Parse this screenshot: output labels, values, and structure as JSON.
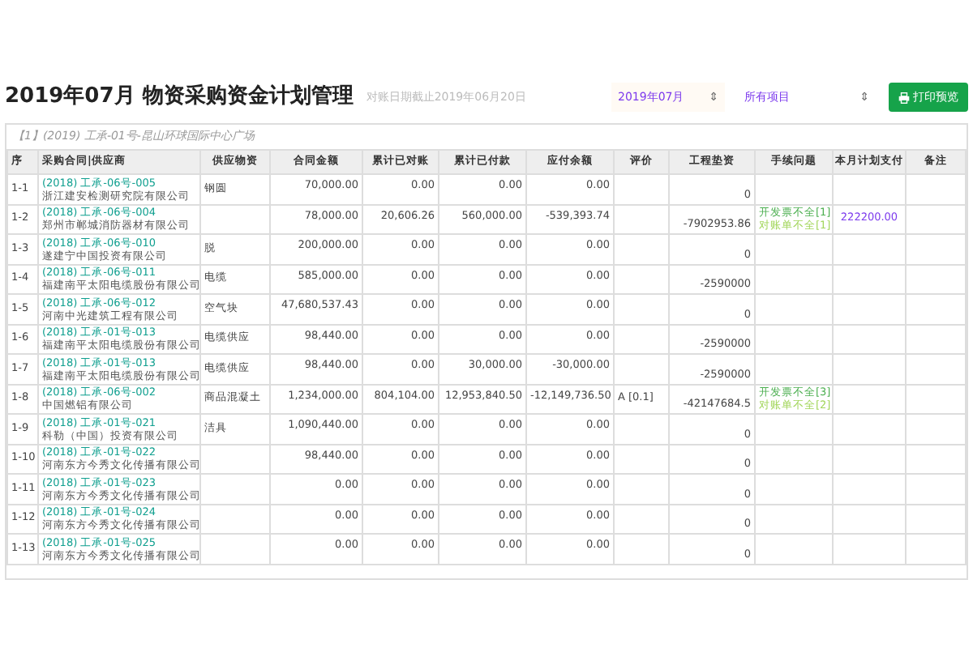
{
  "title": "2019年07月 物资采购资金计划管理",
  "subtitle": "对账日期截止2019年06月20日",
  "month_select": {
    "value": "2019年07月",
    "caret": "⇕"
  },
  "project_select": {
    "value": "所有项目",
    "caret": "⇕"
  },
  "print_button": {
    "label": "打印预览"
  },
  "section": {
    "title": "【1】(2019) 工承-01号-昆山环球国际中心广场"
  },
  "columns": [
    "序",
    "采购合同|供应商",
    "供应物资",
    "合同金额",
    "累计已对账",
    "累计已付款",
    "应付余额",
    "评价",
    "工程垫资",
    "手续问题",
    "本月计划支付",
    "备注"
  ],
  "rows": [
    {
      "no": "1-1",
      "contract": "(2018) 工承-06号-005",
      "supplier": "浙江建安检测研究院有限公司",
      "material": "钢圆",
      "amount": "70,000.00",
      "reconciled": "0.00",
      "paid": "0.00",
      "balance": "0.00",
      "rating": "",
      "advance": "0",
      "issues": [],
      "plan": ""
    },
    {
      "no": "1-2",
      "contract": "(2018) 工承-06号-004",
      "supplier": "郑州市郸城消防器材有限公司",
      "material": "",
      "amount": "78,000.00",
      "reconciled": "20,606.26",
      "paid": "560,000.00",
      "balance": "-539,393.74",
      "rating": "",
      "advance": "-7902953.86",
      "issues": [
        "开发票不全[1]",
        "对账单不全[1]"
      ],
      "plan": "222200.00"
    },
    {
      "no": "1-3",
      "contract": "(2018) 工承-06号-010",
      "supplier": "遂建宁中国投资有限公司",
      "material": "脱",
      "amount": "200,000.00",
      "reconciled": "0.00",
      "paid": "0.00",
      "balance": "0.00",
      "rating": "",
      "advance": "0",
      "issues": [],
      "plan": ""
    },
    {
      "no": "1-4",
      "contract": "(2018) 工承-06号-011",
      "supplier": "福建南平太阳电缆股份有限公司",
      "material": "电缆",
      "amount": "585,000.00",
      "reconciled": "0.00",
      "paid": "0.00",
      "balance": "0.00",
      "rating": "",
      "advance": "-2590000",
      "issues": [],
      "plan": ""
    },
    {
      "no": "1-5",
      "contract": "(2018) 工承-06号-012",
      "supplier": "河南中光建筑工程有限公司",
      "material": "空气块",
      "amount": "47,680,537.43",
      "reconciled": "0.00",
      "paid": "0.00",
      "balance": "0.00",
      "rating": "",
      "advance": "0",
      "issues": [],
      "plan": ""
    },
    {
      "no": "1-6",
      "contract": "(2018) 工承-01号-013",
      "supplier": "福建南平太阳电缆股份有限公司",
      "material": "电缆供应",
      "amount": "98,440.00",
      "reconciled": "0.00",
      "paid": "0.00",
      "balance": "0.00",
      "rating": "",
      "advance": "-2590000",
      "issues": [],
      "plan": ""
    },
    {
      "no": "1-7",
      "contract": "(2018) 工承-01号-013",
      "supplier": "福建南平太阳电缆股份有限公司",
      "material": "电缆供应",
      "amount": "98,440.00",
      "reconciled": "0.00",
      "paid": "30,000.00",
      "balance": "-30,000.00",
      "rating": "",
      "advance": "-2590000",
      "issues": [],
      "plan": ""
    },
    {
      "no": "1-8",
      "contract": "(2018) 工承-06号-002",
      "supplier": "中国燃铝有限公司",
      "material": "商品混凝土",
      "amount": "1,234,000.00",
      "reconciled": "804,104.00",
      "paid": "12,953,840.50",
      "balance": "-12,149,736.50",
      "rating": "A [0.1]",
      "advance": "-42147684.5",
      "issues": [
        "开发票不全[3]",
        "对账单不全[2]"
      ],
      "plan": ""
    },
    {
      "no": "1-9",
      "contract": "(2018) 工承-01号-021",
      "supplier": "科勒（中国）投资有限公司",
      "material": "洁具",
      "amount": "1,090,440.00",
      "reconciled": "0.00",
      "paid": "0.00",
      "balance": "0.00",
      "rating": "",
      "advance": "0",
      "issues": [],
      "plan": ""
    },
    {
      "no": "1-10",
      "contract": "(2018) 工承-01号-022",
      "supplier": "河南东方今秀文化传播有限公司",
      "material": "",
      "amount": "98,440.00",
      "reconciled": "0.00",
      "paid": "0.00",
      "balance": "0.00",
      "rating": "",
      "advance": "0",
      "issues": [],
      "plan": ""
    },
    {
      "no": "1-11",
      "contract": "(2018) 工承-01号-023",
      "supplier": "河南东方今秀文化传播有限公司",
      "material": "",
      "amount": "0.00",
      "reconciled": "0.00",
      "paid": "0.00",
      "balance": "0.00",
      "rating": "",
      "advance": "0",
      "issues": [],
      "plan": ""
    },
    {
      "no": "1-12",
      "contract": "(2018) 工承-01号-024",
      "supplier": "河南东方今秀文化传播有限公司",
      "material": "",
      "amount": "0.00",
      "reconciled": "0.00",
      "paid": "0.00",
      "balance": "0.00",
      "rating": "",
      "advance": "0",
      "issues": [],
      "plan": ""
    },
    {
      "no": "1-13",
      "contract": "(2018) 工承-01号-025",
      "supplier": "河南东方今秀文化传播有限公司",
      "material": "",
      "amount": "0.00",
      "reconciled": "0.00",
      "paid": "0.00",
      "balance": "0.00",
      "rating": "",
      "advance": "0",
      "issues": [],
      "plan": ""
    }
  ]
}
